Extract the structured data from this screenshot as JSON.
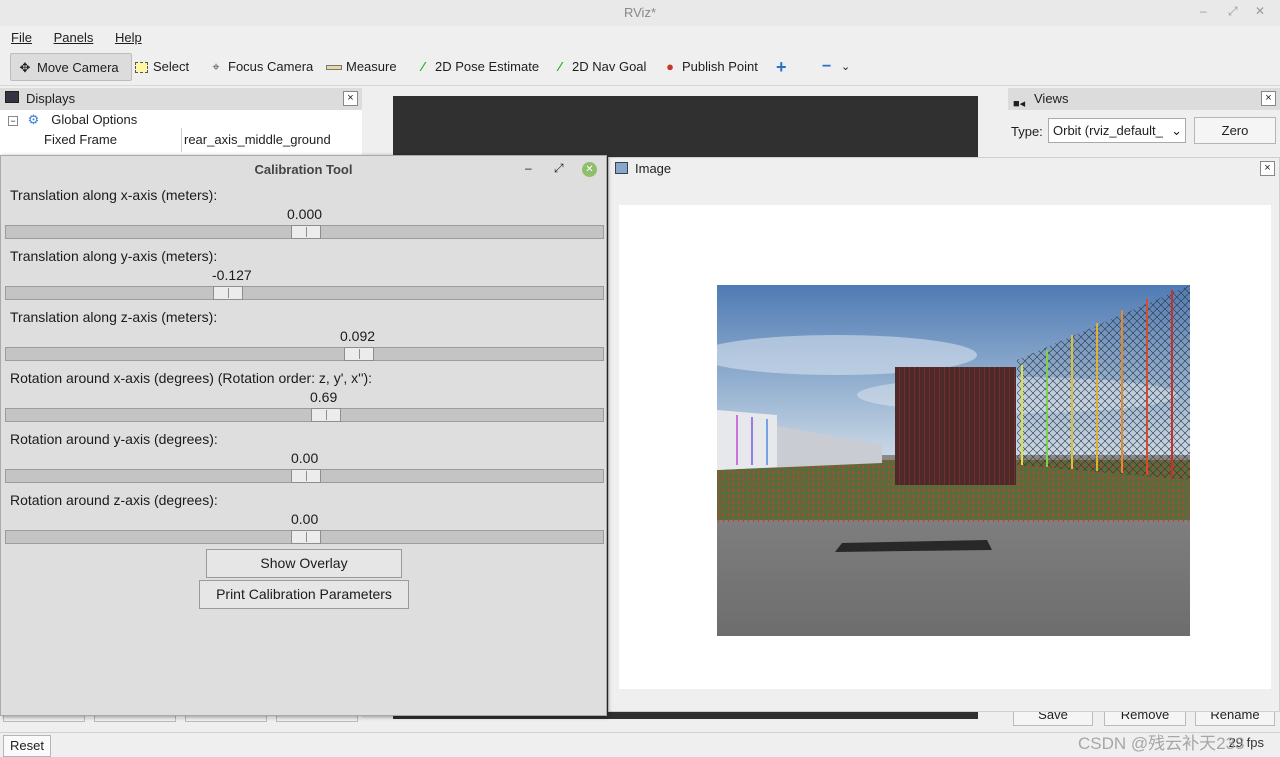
{
  "window": {
    "title": "RViz*"
  },
  "menu": {
    "file": "File",
    "panels": "Panels",
    "help": "Help"
  },
  "toolbar": {
    "move_camera": "Move Camera",
    "select": "Select",
    "focus_camera": "Focus Camera",
    "measure": "Measure",
    "pose_estimate": "2D Pose Estimate",
    "nav_goal": "2D Nav Goal",
    "publish_point": "Publish Point"
  },
  "displays": {
    "title": "Displays",
    "global_options": "Global Options",
    "fixed_frame_label": "Fixed Frame",
    "fixed_frame_value": "rear_axis_middle_ground"
  },
  "views": {
    "title": "Views",
    "type_label": "Type:",
    "type_value": "Orbit (rviz_default_",
    "zero_button": "Zero",
    "save_button": "Save",
    "remove_button": "Remove",
    "rename_button": "Rename"
  },
  "image_panel": {
    "title": "Image"
  },
  "calibration_tool": {
    "title": "Calibration Tool",
    "sliders": [
      {
        "label": "Translation along x-axis (meters):",
        "value": "0.000",
        "position": 0.5
      },
      {
        "label": "Translation along y-axis (meters):",
        "value": "-0.127",
        "position": 0.37
      },
      {
        "label": "Translation along z-axis (meters):",
        "value": "0.092",
        "position": 0.59
      },
      {
        "label": "Rotation around x-axis (degrees) (Rotation order: z, y', x''):",
        "value": "0.69",
        "position": 0.535
      },
      {
        "label": "Rotation around y-axis (degrees):",
        "value": "0.00",
        "position": 0.5
      },
      {
        "label": "Rotation around z-axis (degrees):",
        "value": "0.00",
        "position": 0.5
      }
    ],
    "show_overlay_button": "Show Overlay",
    "print_button": "Print Calibration Parameters"
  },
  "status": {
    "reset_button": "Reset",
    "fps": "29 fps",
    "watermark": "CSDN @残云补天233"
  }
}
